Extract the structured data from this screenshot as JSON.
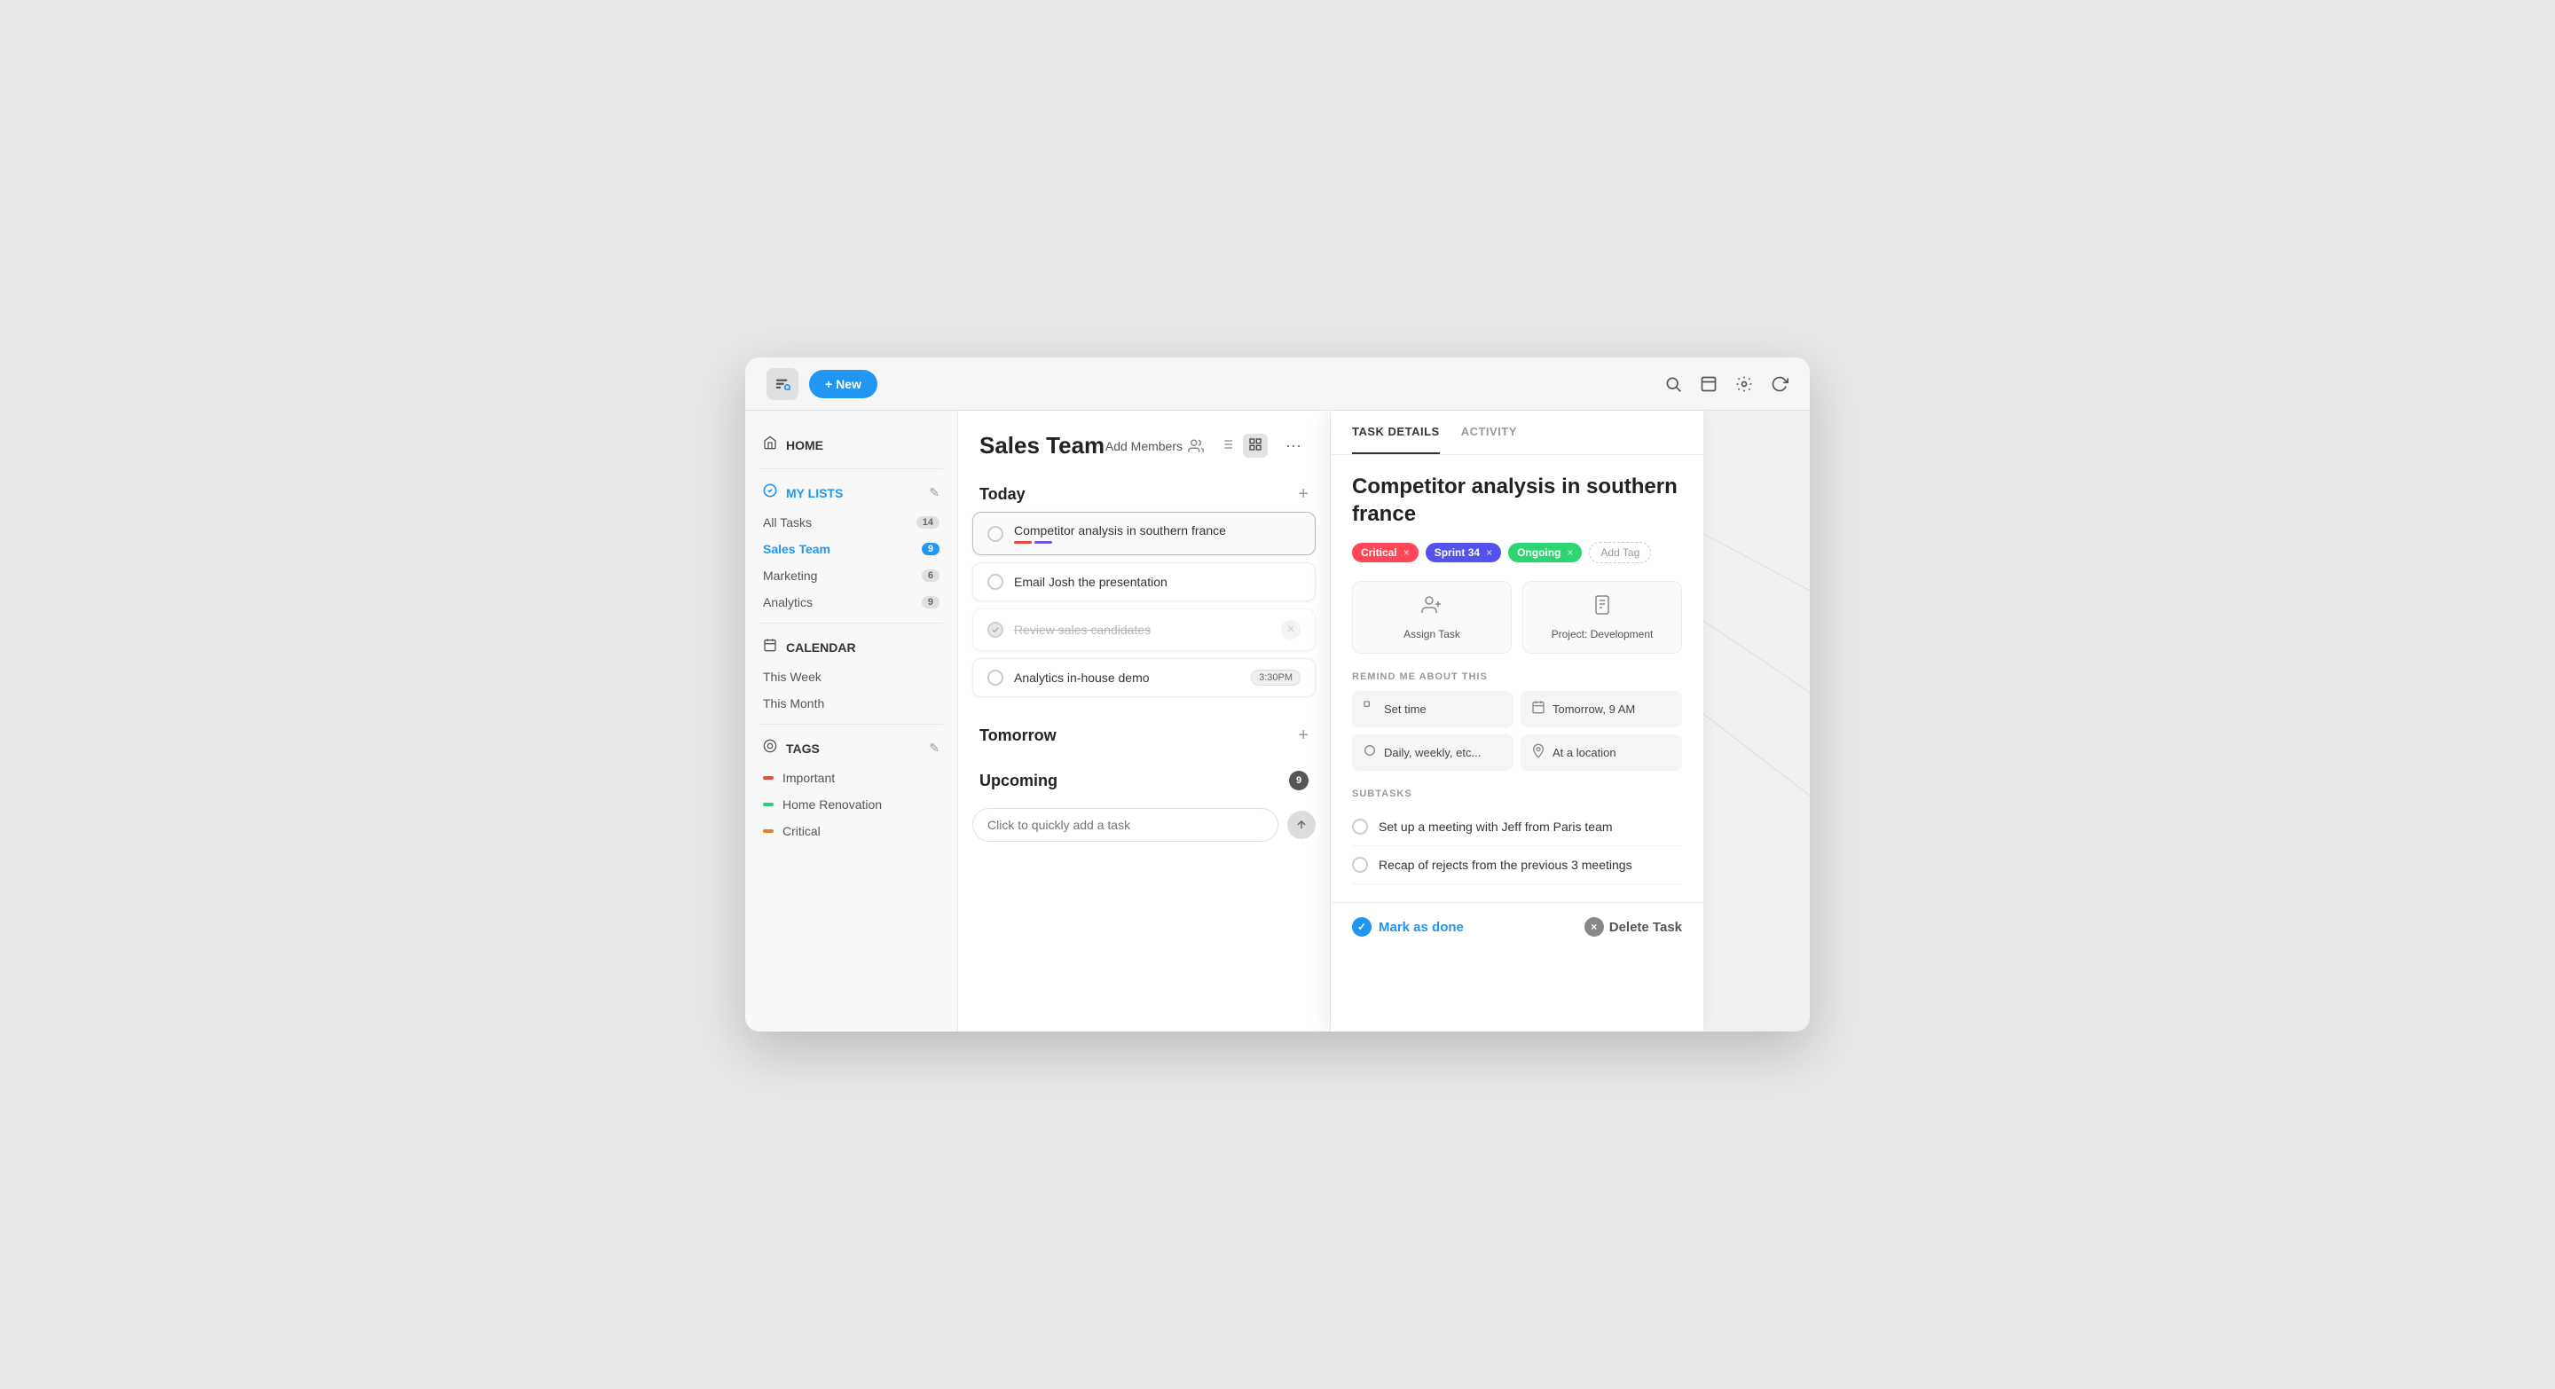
{
  "topbar": {
    "new_label": "+ New",
    "search_icon": "🔍",
    "window_icon": "⧉",
    "settings_icon": "⚙",
    "refresh_icon": "↺"
  },
  "sidebar": {
    "home_label": "HOME",
    "my_lists_label": "MY LISTS",
    "calendar_label": "CALENDAR",
    "tags_label": "TAGS",
    "lists": [
      {
        "label": "All Tasks",
        "count": "14",
        "active": false
      },
      {
        "label": "Sales Team",
        "count": "9",
        "active": true
      },
      {
        "label": "Marketing",
        "count": "6",
        "active": false
      },
      {
        "label": "Analytics",
        "count": "9",
        "active": false
      }
    ],
    "calendar_items": [
      {
        "label": "This Week"
      },
      {
        "label": "This Month"
      }
    ],
    "tags": [
      {
        "label": "Important",
        "color": "#e74c3c"
      },
      {
        "label": "Home Renovation",
        "color": "#2ecc71"
      },
      {
        "label": "Critical",
        "color": "#e67e22"
      }
    ]
  },
  "task_panel": {
    "title": "Sales Team",
    "add_members_label": "Add Members",
    "more_options_label": "...",
    "sections": {
      "today": {
        "title": "Today",
        "tasks": [
          {
            "id": 1,
            "text": "Competitor analysis in southern france",
            "completed": false,
            "selected": true,
            "tags": [],
            "underlines": [
              "#e74c3c",
              "#6c5ce7"
            ]
          },
          {
            "id": 2,
            "text": "Email Josh the presentation",
            "completed": false,
            "selected": false
          },
          {
            "id": 3,
            "text": "Review sales candidates",
            "completed": true,
            "deleted": true
          },
          {
            "id": 4,
            "text": "Analytics in-house demo",
            "completed": false,
            "tag": "3:30PM"
          }
        ]
      },
      "tomorrow": {
        "title": "Tomorrow"
      },
      "upcoming": {
        "title": "Upcoming",
        "count": "9"
      }
    },
    "quick_add_placeholder": "Click to quickly add a task"
  },
  "detail_panel": {
    "tab_details": "TASK DETAILS",
    "tab_activity": "ACTIVITY",
    "title": "Competitor analysis in southern france",
    "tags": [
      {
        "label": "Critical",
        "type": "critical"
      },
      {
        "label": "Sprint 34",
        "type": "sprint"
      },
      {
        "label": "Ongoing",
        "type": "ongoing"
      }
    ],
    "add_tag_label": "Add Tag",
    "actions": [
      {
        "icon": "👤",
        "label": "Assign Task"
      },
      {
        "icon": "📋",
        "label": "Project: Development"
      }
    ],
    "remind_section_label": "REMIND ME ABOUT THIS",
    "remind_items": [
      {
        "icon": "⏰",
        "label": "Set time"
      },
      {
        "icon": "📅",
        "label": "Tomorrow, 9 AM"
      },
      {
        "icon": "🔄",
        "label": "Daily, weekly, etc..."
      },
      {
        "icon": "📍",
        "label": "At a location"
      }
    ],
    "subtasks_label": "SUBTASKS",
    "subtasks": [
      {
        "id": 1,
        "text": "Set up a meeting with Jeff from Paris team",
        "completed": false
      },
      {
        "id": 2,
        "text": "Recap of rejects from the previous 3 meetings",
        "completed": false
      }
    ],
    "mark_done_label": "Mark as done",
    "delete_label": "Delete Task"
  }
}
